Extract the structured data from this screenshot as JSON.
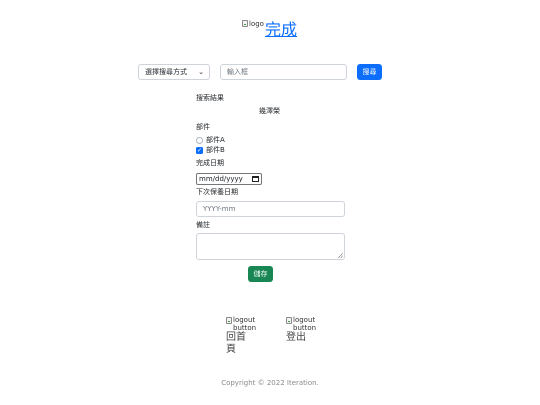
{
  "header": {
    "logo_alt": "logo",
    "title": "完成"
  },
  "search": {
    "select_value": "選擇搜尋方式",
    "placeholder": "輸入框",
    "button_label": "搜尋"
  },
  "form": {
    "result_label": "搜索結果",
    "result_value": "幾澤榮",
    "part_label": "部件",
    "part_a": "部件A",
    "part_b": "部件B",
    "date_label": "完成日期",
    "date_value": "mm/dd/yyyy",
    "next_date_label": "下次保養日期",
    "next_date_placeholder": "YYYY-mm",
    "note_label": "備註",
    "save_label": "儲存"
  },
  "nav": {
    "home_alt": "logout button",
    "home_label": "回首頁",
    "logout_alt": "logout button",
    "logout_label": "登出"
  },
  "footer": {
    "text": "Copyright © 2022 Iteration."
  },
  "colors": {
    "primary": "#0d6efd",
    "success": "#198754",
    "link": "#0d6efd",
    "muted": "#8a8a8a"
  },
  "icons": {
    "broken_image": "broken-image-icon",
    "dropdown": "chevron-down-icon",
    "calendar": "calendar-icon",
    "checkbox": "check-icon"
  }
}
